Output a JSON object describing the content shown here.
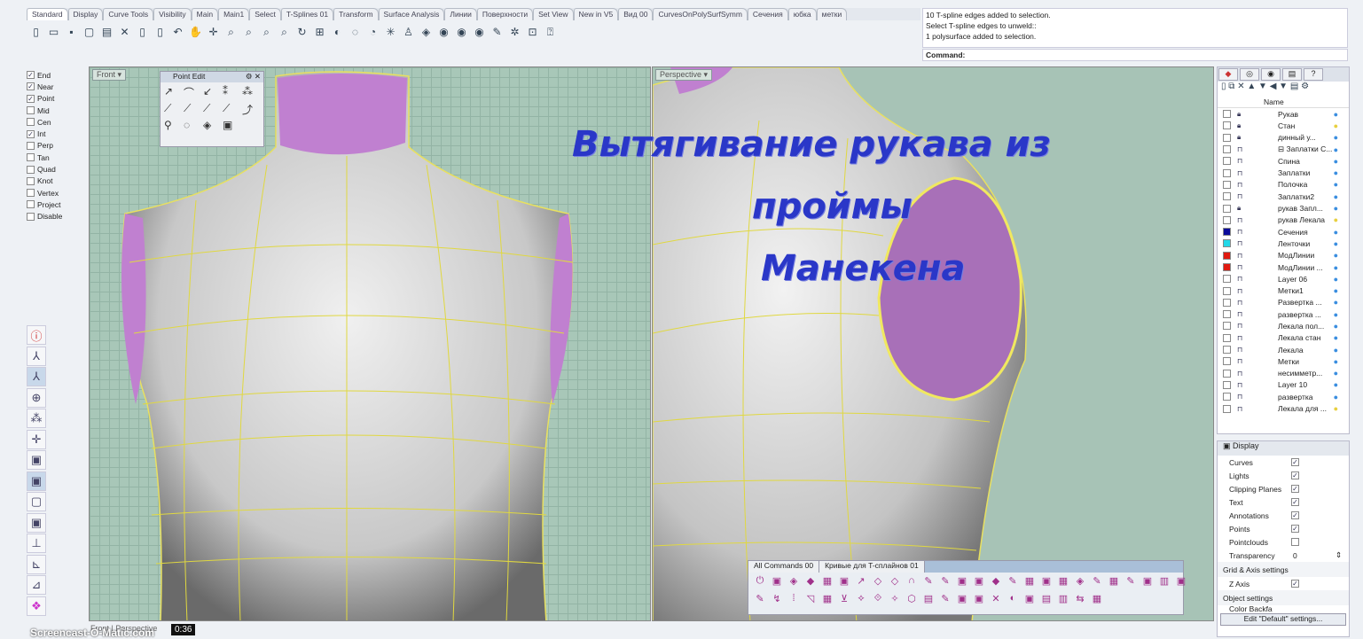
{
  "tabs": [
    "Standard",
    "Display",
    "Curve Tools",
    "Visibility",
    "Main",
    "Main1",
    "Select",
    "T-Splines 01",
    "Transform",
    "Surface Analysis",
    "Линии",
    "Поверхности",
    "Set View",
    "New in V5",
    "Вид 00",
    "CurvesOnPolySurfSymm",
    "Сечения",
    "юбка",
    "метки"
  ],
  "command": {
    "history": [
      "10 T-spline edges added to selection.",
      "Select T-spline edges to unweld::",
      "1 polysurface added to selection."
    ],
    "prompt": "Command:"
  },
  "osnap": [
    {
      "label": "End",
      "checked": true
    },
    {
      "label": "Near",
      "checked": true
    },
    {
      "label": "Point",
      "checked": true
    },
    {
      "label": "Mid",
      "checked": false
    },
    {
      "label": "Cen",
      "checked": false
    },
    {
      "label": "Int",
      "checked": true
    },
    {
      "label": "Perp",
      "checked": false
    },
    {
      "label": "Tan",
      "checked": false
    },
    {
      "label": "Quad",
      "checked": false
    },
    {
      "label": "Knot",
      "checked": false
    },
    {
      "label": "Vertex",
      "checked": false
    },
    {
      "label": "Project",
      "checked": false
    },
    {
      "label": "Disable",
      "checked": false
    }
  ],
  "viewports": {
    "front": "Front",
    "perspective": "Perspective"
  },
  "point_edit": {
    "title": "Point Edit"
  },
  "overlay": {
    "line1": "Вытягивание рукава из",
    "line2": "проймы",
    "line3": "Манекена",
    "color": "#2a37c8"
  },
  "layers": {
    "header": "Name",
    "rows": [
      {
        "name": "Рукав",
        "locked": true,
        "color": "",
        "bulb": "on"
      },
      {
        "name": "Стан",
        "locked": true,
        "color": "",
        "bulb": "off"
      },
      {
        "name": "динный у...",
        "locked": true,
        "color": "",
        "bulb": "on"
      },
      {
        "name": "⊟ Заплатки С...",
        "locked": false,
        "color": "",
        "bulb": "on"
      },
      {
        "name": "Спина",
        "locked": false,
        "color": "",
        "bulb": "on"
      },
      {
        "name": "Заплатки",
        "locked": false,
        "color": "",
        "bulb": "on"
      },
      {
        "name": "Полочка",
        "locked": false,
        "color": "",
        "bulb": "on"
      },
      {
        "name": "Заплатки2",
        "locked": false,
        "color": "",
        "bulb": "on"
      },
      {
        "name": "рукав Запл...",
        "locked": true,
        "color": "",
        "bulb": "on"
      },
      {
        "name": "рукав Лекала",
        "locked": false,
        "color": "",
        "bulb": "off"
      },
      {
        "name": "Сечения",
        "locked": false,
        "color": "#0b0b9a",
        "bulb": "on"
      },
      {
        "name": "Ленточки",
        "locked": false,
        "color": "#22d8e8",
        "bulb": "on"
      },
      {
        "name": "МодЛинии",
        "locked": false,
        "color": "#e01a10",
        "bulb": "on"
      },
      {
        "name": "МодЛинии ...",
        "locked": false,
        "color": "#e01a10",
        "bulb": "on"
      },
      {
        "name": "Layer 06",
        "locked": false,
        "color": "",
        "bulb": "on"
      },
      {
        "name": "Метки1",
        "locked": false,
        "color": "",
        "bulb": "on"
      },
      {
        "name": "Развертка ...",
        "locked": false,
        "color": "",
        "bulb": "on"
      },
      {
        "name": "развертка ...",
        "locked": false,
        "color": "",
        "bulb": "on"
      },
      {
        "name": "Лекала пол...",
        "locked": false,
        "color": "",
        "bulb": "on"
      },
      {
        "name": "Лекала стан",
        "locked": false,
        "color": "",
        "bulb": "on"
      },
      {
        "name": "Лекала",
        "locked": false,
        "color": "",
        "bulb": "on"
      },
      {
        "name": "Метки",
        "locked": false,
        "color": "",
        "bulb": "on"
      },
      {
        "name": "несимметр...",
        "locked": false,
        "color": "",
        "bulb": "on"
      },
      {
        "name": "Layer 10",
        "locked": false,
        "color": "",
        "bulb": "on"
      },
      {
        "name": "развертка",
        "locked": false,
        "color": "",
        "bulb": "on"
      },
      {
        "name": "Лекала для ...",
        "locked": false,
        "color": "",
        "bulb": "off"
      }
    ]
  },
  "display": {
    "tab": "Display",
    "rows": [
      {
        "label": "Curves",
        "checked": true
      },
      {
        "label": "Lights",
        "checked": true
      },
      {
        "label": "Clipping Planes",
        "checked": true
      },
      {
        "label": "Text",
        "checked": true
      },
      {
        "label": "Annotations",
        "checked": true
      },
      {
        "label": "Points",
        "checked": true
      },
      {
        "label": "Pointclouds",
        "checked": false
      }
    ],
    "transparency_label": "Transparency",
    "transparency_value": "0",
    "grid_section": "Grid & Axis settings",
    "z_axis": "Z Axis",
    "object_section": "Object settings",
    "color_row": "Color Backfa",
    "edit_button": "Edit \"Default\" settings..."
  },
  "command_panel": {
    "tabs": [
      "All Commands 00",
      "Кривые для T-сплайнов 01"
    ]
  },
  "bottom": {
    "viewport_tabs": [
      "Front",
      "Perspective"
    ],
    "watermark": "Screencast-O-Matic.com",
    "time": "0:36"
  }
}
